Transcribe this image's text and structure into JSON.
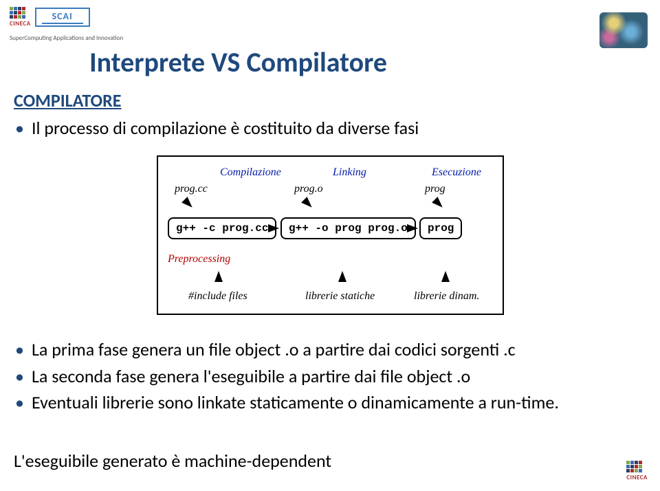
{
  "header": {
    "brand_small": "CINECA",
    "brand_big": "SCAI",
    "tagline": "SuperComputing Applications and Innovation"
  },
  "title": "Interprete VS Compilatore",
  "section_heading": "COMPILATORE",
  "bullets_top": [
    "Il processo di compilazione è costituito da diverse fasi"
  ],
  "bullets_bottom": [
    "La prima fase genera un file object .o a partire dai codici sorgenti .c",
    "La seconda fase genera l'eseguibile a partire dai file object .o",
    "Eventuali librerie sono linkate staticamente o dinamicamente a run-time."
  ],
  "footer_line": "L'eseguibile generato è machine-dependent",
  "diagram": {
    "stages": {
      "compile": "Compilazione",
      "link": "Linking",
      "exec": "Esecuzione"
    },
    "files": {
      "src": "prog.cc",
      "obj": "prog.o",
      "bin": "prog"
    },
    "commands": {
      "compile": "g++ -c prog.cc",
      "link": "g++ -o prog prog.o",
      "run": "prog"
    },
    "preprocessing_label": "Preprocessing",
    "inputs": {
      "includes": "#include files",
      "static_libs": "librerie statiche",
      "dyn_libs": "librerie dinam."
    }
  }
}
